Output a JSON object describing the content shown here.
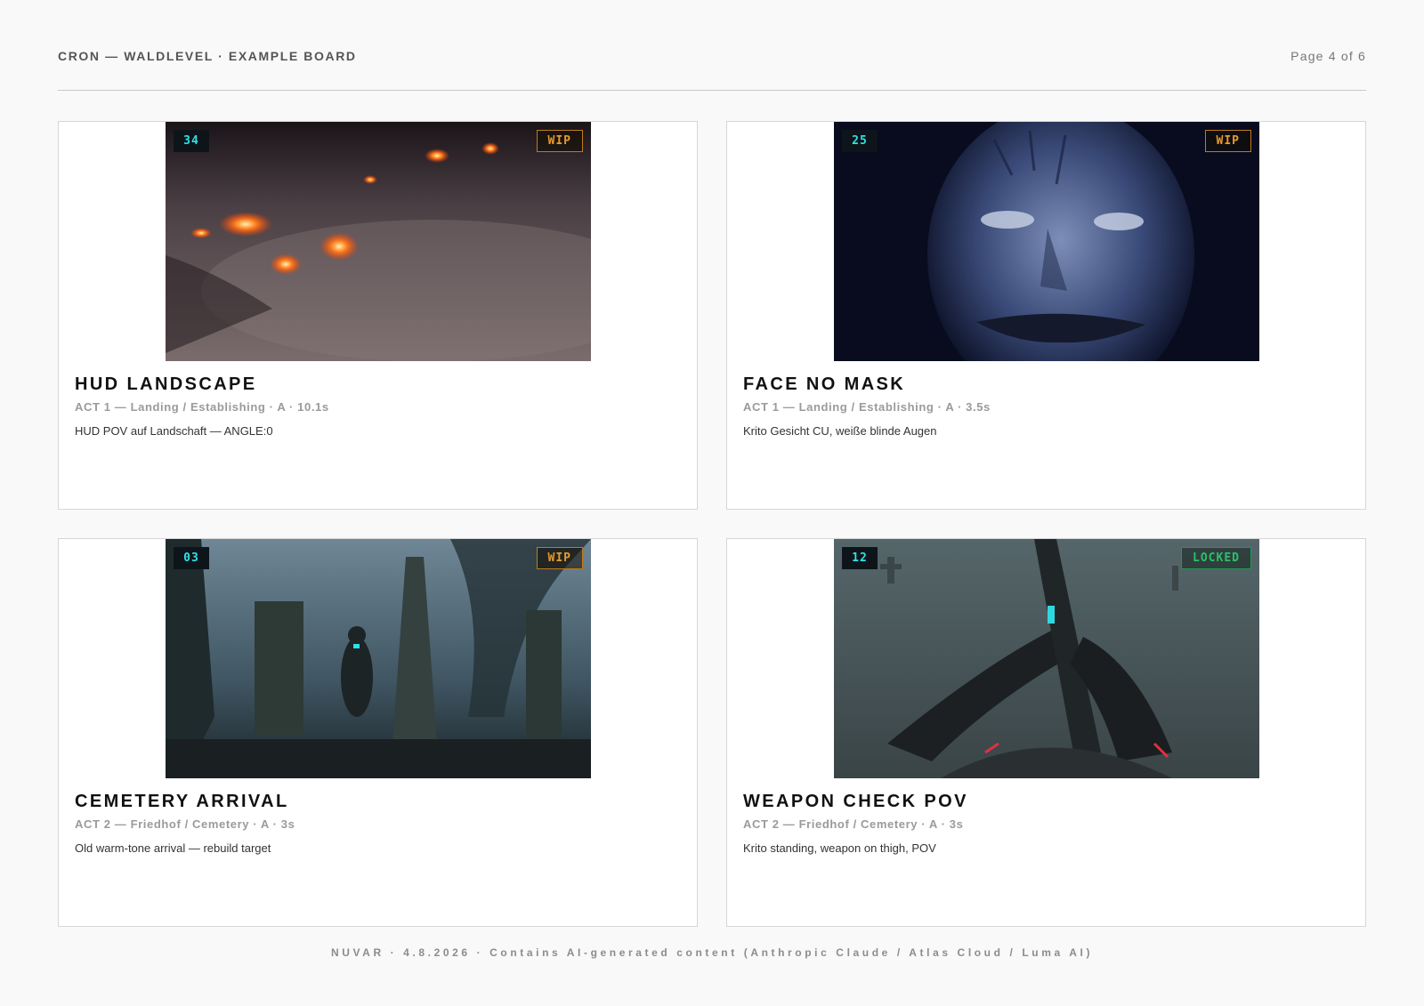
{
  "header": {
    "board_title": "CRON — WALDLEVEL · EXAMPLE BOARD",
    "page_indicator": "Page 4 of 6"
  },
  "shots": [
    {
      "number": "34",
      "status": "WIP",
      "title": "HUD LANDSCAPE",
      "meta": "ACT 1 — Landing / Establishing · A · 10.1s",
      "description": "HUD POV auf Landschaft — ANGLE:0"
    },
    {
      "number": "25",
      "status": "WIP",
      "title": "FACE NO MASK",
      "meta": "ACT 1 — Landing / Establishing · A · 3.5s",
      "description": "Krito Gesicht CU, weiße blinde Augen"
    },
    {
      "number": "03",
      "status": "WIP",
      "title": "CEMETERY ARRIVAL",
      "meta": "ACT 2 — Friedhof / Cemetery · A · 3s",
      "description": "Old warm-tone arrival — rebuild target"
    },
    {
      "number": "12",
      "status": "LOCKED",
      "title": "WEAPON CHECK POV",
      "meta": "ACT 2 — Friedhof / Cemetery · A · 3s",
      "description": "Krito standing, weapon on thigh, POV"
    }
  ],
  "footer": {
    "text": "NUVAR · 4.8.2026 · Contains AI-generated content (Anthropic Claude / Atlas Cloud / Luma AI)"
  },
  "colors": {
    "wip": "#e89a2c",
    "locked": "#27c26a",
    "number_badge_text": "#2ee3e8"
  }
}
